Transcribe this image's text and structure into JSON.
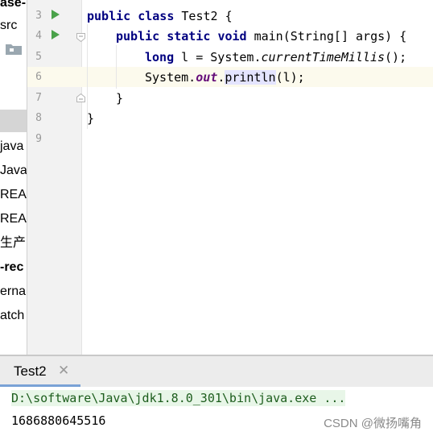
{
  "project_tree": {
    "items": [
      "ase-",
      "src",
      "java",
      "Java",
      "REA",
      "REA",
      "生产",
      "-rec",
      "erna",
      "atch"
    ]
  },
  "editor": {
    "line_numbers": [
      "3",
      "4",
      "5",
      "6",
      "7",
      "8",
      "9"
    ],
    "lines": {
      "l3": {
        "kw1": "public",
        "kw2": "class",
        "rest": " Test2 {"
      },
      "l4": {
        "kw1": "public",
        "kw2": "static",
        "kw3": "void",
        "rest": " main(String[] args) {"
      },
      "l5": {
        "kw": "long",
        "pre": " l = System.",
        "method": "currentTimeMillis",
        "post": "();"
      },
      "l6": {
        "pre": "System.",
        "field": "out",
        "dot": ".",
        "method": "println",
        "post": "(l);"
      },
      "l7": {
        "text": "}"
      },
      "l8": {
        "text": "}"
      }
    }
  },
  "run_panel": {
    "tab_label": "Test2",
    "close_glyph": "✕",
    "command": "D:\\software\\Java\\jdk1.8.0_301\\bin\\java.exe ...",
    "output": "1686880645516"
  },
  "watermark": "CSDN @微扬嘴角",
  "colors": {
    "keyword": "#000080",
    "run_icon": "#4aa24a",
    "current_line": "#fcfaed",
    "tab_underline": "#7aa2d6"
  }
}
